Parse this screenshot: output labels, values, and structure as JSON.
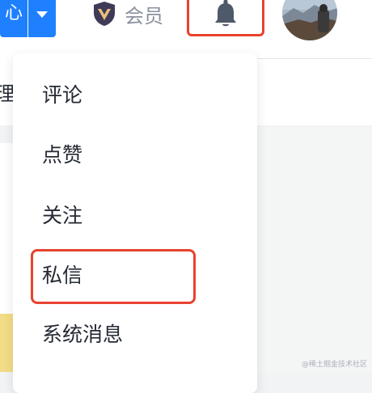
{
  "header": {
    "button_partial_text": "心",
    "vip_label": "会员",
    "icons": {
      "vip": "vip-badge-icon",
      "notification": "bell-icon",
      "dropdown": "chevron-down-icon"
    }
  },
  "left_tab_partial": "理",
  "notification_menu": {
    "items": [
      {
        "label": "评论"
      },
      {
        "label": "点赞"
      },
      {
        "label": "关注"
      },
      {
        "label": "私信"
      },
      {
        "label": "系统消息"
      }
    ],
    "highlighted_item": "私信"
  },
  "watermark": "@稀土掘金技术社区",
  "colors": {
    "brand_blue": "#1e80ff",
    "annotation_red": "#e8432e",
    "text_primary": "#252933",
    "text_muted": "#8a919f"
  }
}
